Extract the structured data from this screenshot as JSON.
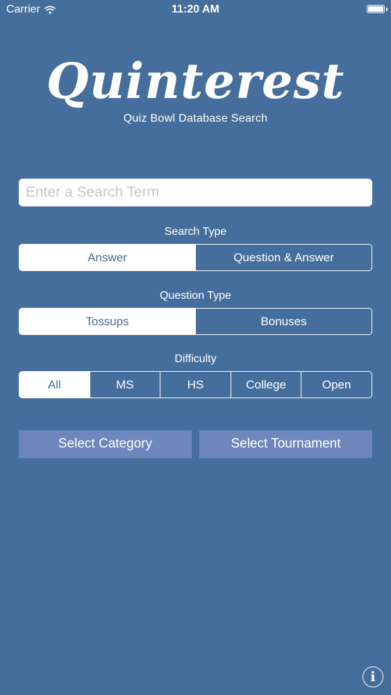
{
  "status_bar": {
    "carrier": "Carrier",
    "time": "11:20 AM"
  },
  "app": {
    "logo_text": "Quinterest",
    "subtitle": "Quiz Bowl Database Search"
  },
  "search": {
    "placeholder": "Enter a Search Term",
    "value": ""
  },
  "search_type": {
    "label": "Search Type",
    "options": [
      "Answer",
      "Question & Answer"
    ],
    "selected": "Answer"
  },
  "question_type": {
    "label": "Question Type",
    "options": [
      "Tossups",
      "Bonuses"
    ],
    "selected": "Tossups"
  },
  "difficulty": {
    "label": "Difficulty",
    "options": [
      "All",
      "MS",
      "HS",
      "College",
      "Open"
    ],
    "selected": "All"
  },
  "buttons": {
    "select_category": "Select Category",
    "select_tournament": "Select Tournament",
    "info_glyph": "i"
  },
  "colors": {
    "background": "#456e9c",
    "button_fill": "#6d87bd",
    "foreground": "#ffffff"
  }
}
